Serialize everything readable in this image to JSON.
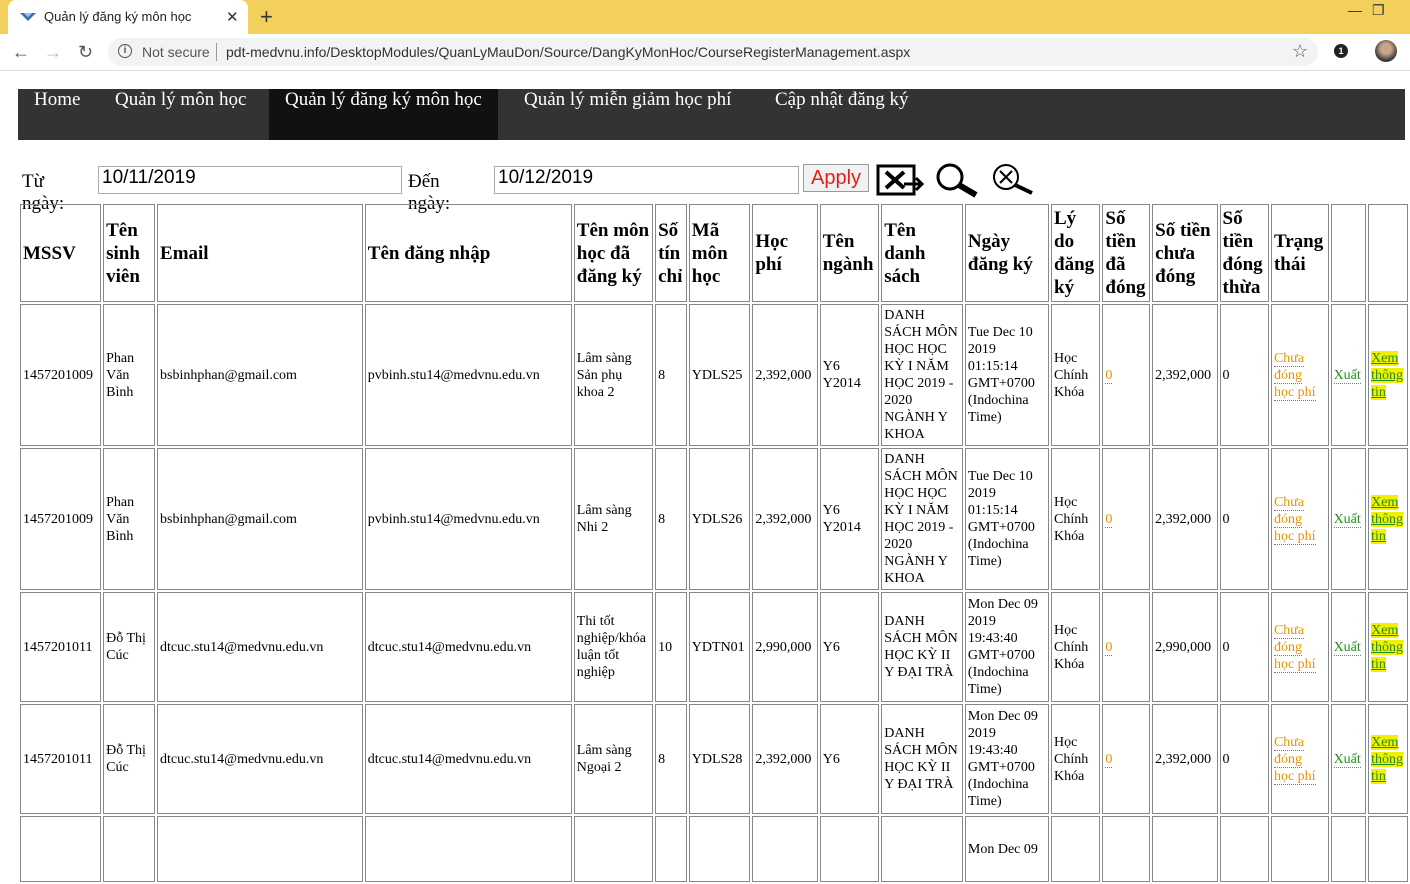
{
  "browser": {
    "tab_title": "Quản lý đăng ký môn học",
    "security_label": "Not secure",
    "url": "pdt-medvnu.info/DesktopModules/QuanLyMauDon/Source/DangKyMonHoc/CourseRegisterManagement.aspx"
  },
  "nav": {
    "items": [
      {
        "label": "Home"
      },
      {
        "label": "Quản lý môn học"
      },
      {
        "label": "Quản lý đăng ký môn học"
      },
      {
        "label": "Quản lý miễn giảm học phí"
      },
      {
        "label": "Cập nhật đăng ký"
      }
    ]
  },
  "filter": {
    "from_label": "Từ ngày:",
    "from_value": "10/11/2019",
    "to_label": "Đến ngày:",
    "to_value": "10/12/2019",
    "apply_label": "Apply"
  },
  "table": {
    "headers": [
      "MSSV",
      "Tên sinh viên",
      "Email",
      "Tên đăng nhập",
      "Tên môn học đã đăng ký",
      "Số tín chỉ",
      "Mã môn học",
      "Học phí",
      "Tên ngành",
      "Tên danh sách",
      "Ngày đăng ký",
      "Lý do đăng ký",
      "Số tiền đã đóng",
      "Số tiền chưa đóng",
      "Số tiền đóng thừa",
      "Trạng thái",
      "",
      ""
    ],
    "rows": [
      {
        "mssv": "1457201009",
        "name": "Phan Văn Bình",
        "email": "bsbinhphan@gmail.com",
        "username": "pvbinh.stu14@medvnu.edu.vn",
        "course": "Lâm sàng Sản phụ khoa 2",
        "credits": "8",
        "code": "YDLS25",
        "fee": "2,392,000",
        "major": "Y6 Y2014",
        "list": "DANH SÁCH MÔN HỌC HỌC KỲ I NĂM HỌC 2019 - 2020 NGÀNH Y KHOA",
        "date": "Tue Dec 10 2019 01:15:14 GMT+0700 (Indochina Time)",
        "reason": "Học Chính Khóa",
        "paid": "0",
        "unpaid": "2,392,000",
        "excess": "0",
        "status": "Chưa đóng học phí",
        "export": "Xuất",
        "view": "Xem thông tin"
      },
      {
        "mssv": "1457201009",
        "name": "Phan Văn Bình",
        "email": "bsbinhphan@gmail.com",
        "username": "pvbinh.stu14@medvnu.edu.vn",
        "course": "Lâm sàng Nhi 2",
        "credits": "8",
        "code": "YDLS26",
        "fee": "2,392,000",
        "major": "Y6 Y2014",
        "list": "DANH SÁCH MÔN HỌC HỌC KỲ I NĂM HỌC 2019 - 2020 NGÀNH Y KHOA",
        "date": "Tue Dec 10 2019 01:15:14 GMT+0700 (Indochina Time)",
        "reason": "Học Chính Khóa",
        "paid": "0",
        "unpaid": "2,392,000",
        "excess": "0",
        "status": "Chưa đóng học phí",
        "export": "Xuất",
        "view": "Xem thông tin"
      },
      {
        "mssv": "1457201011",
        "name": "Đỗ Thị Cúc",
        "email": "dtcuc.stu14@medvnu.edu.vn",
        "username": "dtcuc.stu14@medvnu.edu.vn",
        "course": "Thi tốt nghiệp/khóa luận tốt nghiệp",
        "credits": "10",
        "code": "YDTN01",
        "fee": "2,990,000",
        "major": "Y6",
        "list": "DANH SÁCH MÔN HỌC KỲ II Y ĐẠI TRÀ",
        "date": "Mon Dec 09 2019 19:43:40 GMT+0700 (Indochina Time)",
        "reason": "Học Chính Khóa",
        "paid": "0",
        "unpaid": "2,990,000",
        "excess": "0",
        "status": "Chưa đóng học phí",
        "export": "Xuất",
        "view": "Xem thông tin"
      },
      {
        "mssv": "1457201011",
        "name": "Đỗ Thị Cúc",
        "email": "dtcuc.stu14@medvnu.edu.vn",
        "username": "dtcuc.stu14@medvnu.edu.vn",
        "course": "Lâm sàng Ngoại 2",
        "credits": "8",
        "code": "YDLS28",
        "fee": "2,392,000",
        "major": "Y6",
        "list": "DANH SÁCH MÔN HỌC KỲ II Y ĐẠI TRÀ",
        "date": "Mon Dec 09 2019 19:43:40 GMT+0700 (Indochina Time)",
        "reason": "Học Chính Khóa",
        "paid": "0",
        "unpaid": "2,392,000",
        "excess": "0",
        "status": "Chưa đóng học phí",
        "export": "Xuất",
        "view": "Xem thông tin"
      },
      {
        "mssv": "",
        "name": "",
        "email": "",
        "username": "",
        "course": "",
        "credits": "",
        "code": "",
        "fee": "",
        "major": "",
        "list": "",
        "date": "Mon Dec 09",
        "reason": "",
        "paid": "",
        "unpaid": "",
        "excess": "",
        "status": "",
        "export": "",
        "view": ""
      }
    ]
  }
}
